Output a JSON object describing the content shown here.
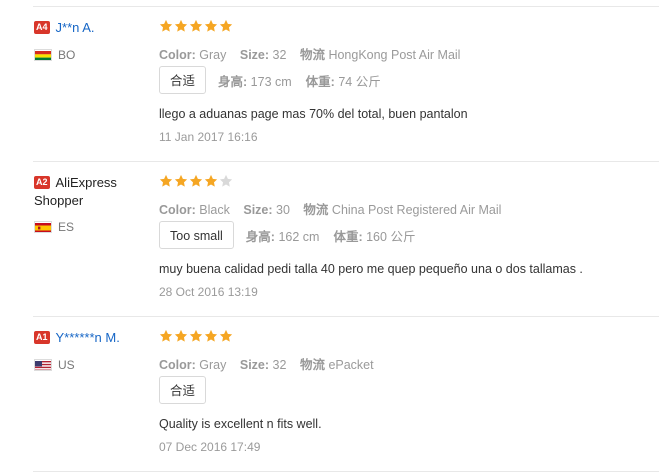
{
  "reviews": [
    {
      "level": "A4",
      "name": "J**n A.",
      "name_style": "link",
      "country": "BO",
      "flag": "bolivia",
      "rating": 5,
      "color_label": "Color:",
      "color": "Gray",
      "size_label": "Size:",
      "size": "32",
      "ship_label": "物流",
      "shipping": "HongKong Post Air Mail",
      "fit": "合适",
      "height_label": "身高:",
      "height": "173 cm",
      "weight_label": "体重:",
      "weight": "74 公斤",
      "text": "llego a aduanas page mas 70% del total, buen pantalon",
      "date": "11 Jan 2017 16:16"
    },
    {
      "level": "A2",
      "name": "AliExpress Shopper",
      "name_style": "plain",
      "country": "ES",
      "flag": "spain",
      "rating": 4,
      "color_label": "Color:",
      "color": "Black",
      "size_label": "Size:",
      "size": "30",
      "ship_label": "物流",
      "shipping": "China Post Registered Air Mail",
      "fit": "Too small",
      "height_label": "身高:",
      "height": "162 cm",
      "weight_label": "体重:",
      "weight": "160 公斤",
      "text": "muy buena calidad pedi talla 40 pero me quep pequeño una o dos tallamas .",
      "date": "28 Oct 2016 13:19"
    },
    {
      "level": "A1",
      "name": "Y******n M.",
      "name_style": "link",
      "country": "US",
      "flag": "usa",
      "rating": 5,
      "color_label": "Color:",
      "color": "Gray",
      "size_label": "Size:",
      "size": "32",
      "ship_label": "物流",
      "shipping": "ePacket",
      "fit": "合适",
      "text": "Quality is excellent n fits well.",
      "date": "07 Dec 2016 17:49"
    }
  ],
  "colors": {
    "star": "#f5a623",
    "star_empty": "#d9d9d9",
    "link": "#1666c6",
    "badge": "#d8362a"
  }
}
